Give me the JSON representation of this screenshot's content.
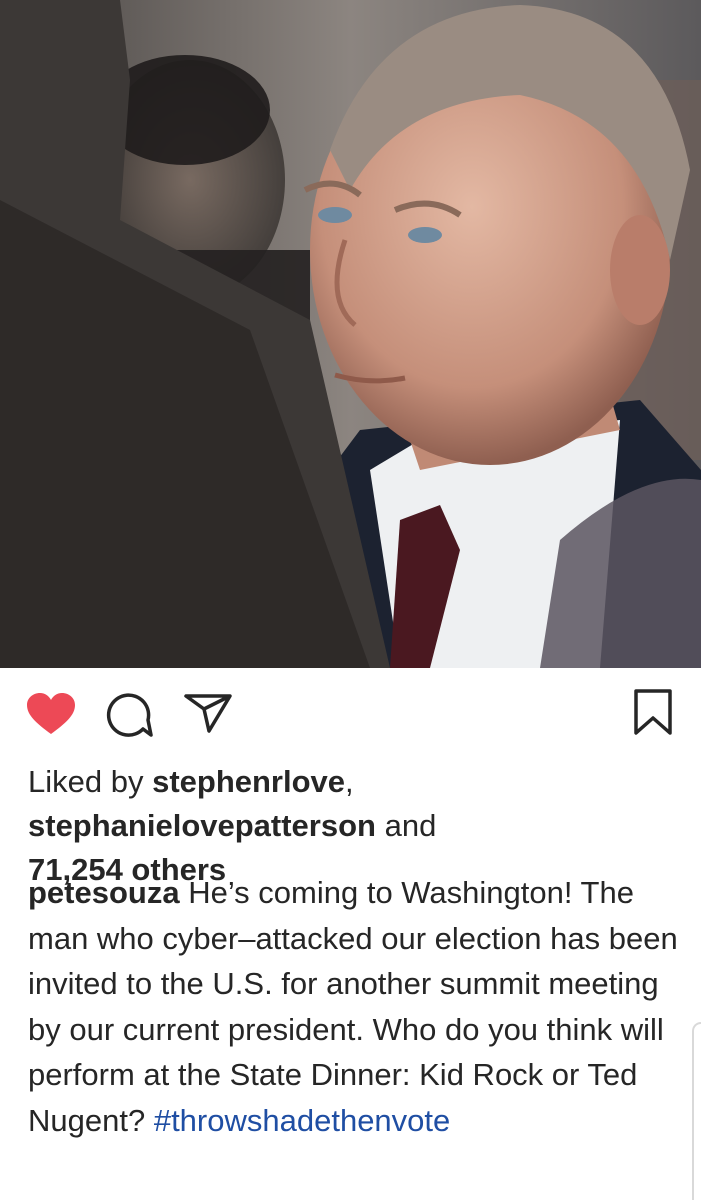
{
  "post": {
    "photo": {
      "icon": "post-photo"
    },
    "actions": {
      "like_icon": "heart-filled-icon",
      "comment_icon": "comment-icon",
      "share_icon": "share-icon",
      "save_icon": "bookmark-icon",
      "like_color": "#ed4956"
    },
    "likes": {
      "prefix": "Liked by ",
      "user1": "stephenrlove",
      "separator": ",",
      "user2": "stephanielovepatterson",
      "conjunction": " and",
      "others": "71,254 others"
    },
    "caption": {
      "username": "petesouza",
      "text": " He’s coming to Washington! The man who cyber–attacked our election has been invited to the U.S. for another summit meeting by our current president. Who do you think will perform at the State Dinner: Kid Rock or Ted Nugent? ",
      "hashtag": "#throwshadethenvote"
    }
  }
}
